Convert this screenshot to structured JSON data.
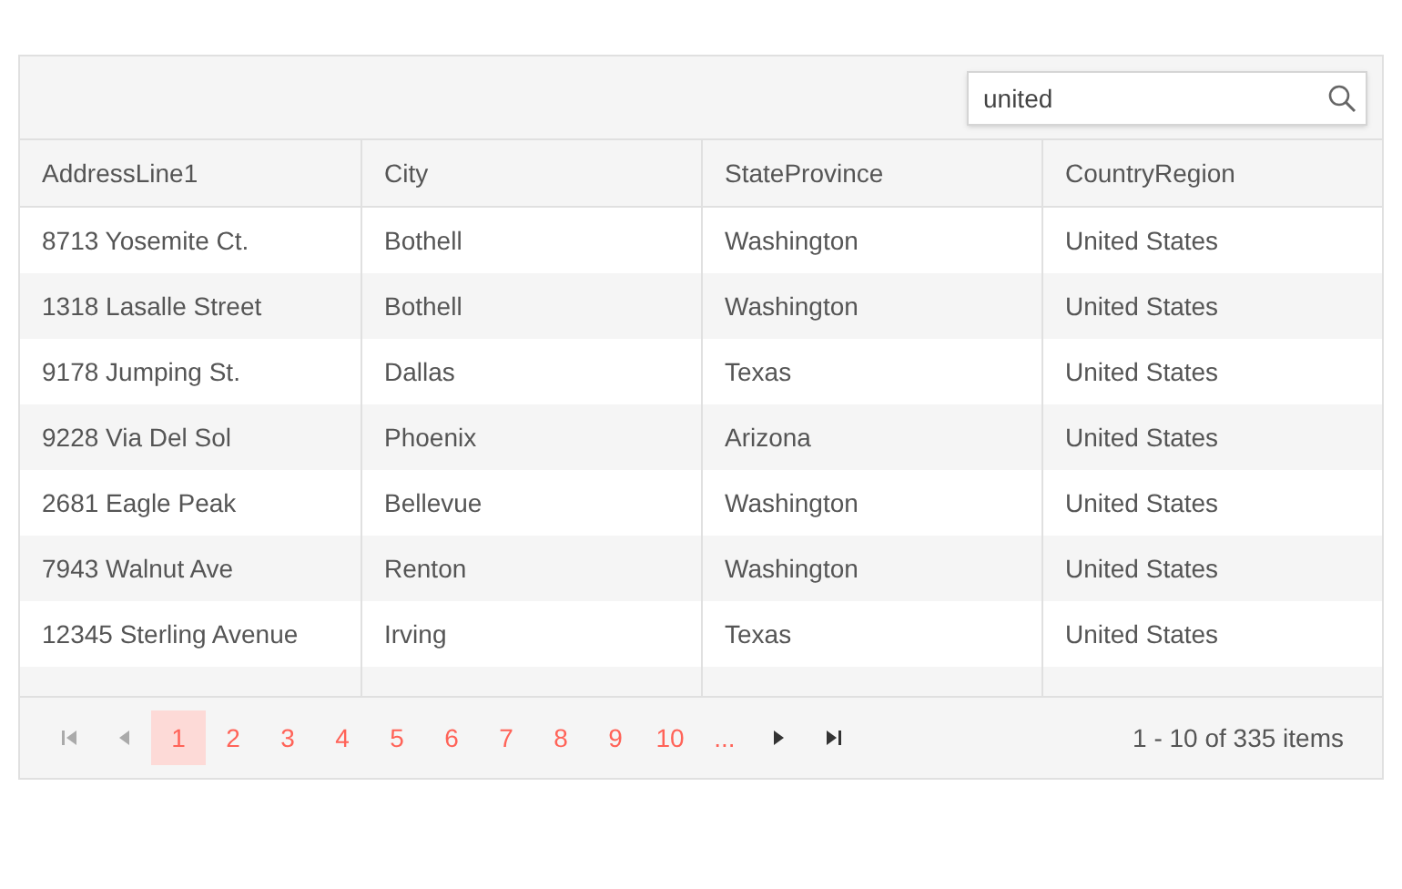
{
  "search": {
    "value": "united"
  },
  "table": {
    "columns": [
      "AddressLine1",
      "City",
      "StateProvince",
      "CountryRegion"
    ],
    "rows": [
      [
        "8713 Yosemite Ct.",
        "Bothell",
        "Washington",
        "United States"
      ],
      [
        "1318 Lasalle Street",
        "Bothell",
        "Washington",
        "United States"
      ],
      [
        "9178 Jumping St.",
        "Dallas",
        "Texas",
        "United States"
      ],
      [
        "9228 Via Del Sol",
        "Phoenix",
        "Arizona",
        "United States"
      ],
      [
        "2681 Eagle Peak",
        "Bellevue",
        "Washington",
        "United States"
      ],
      [
        "7943 Walnut Ave",
        "Renton",
        "Washington",
        "United States"
      ],
      [
        "12345 Sterling Avenue",
        "Irving",
        "Texas",
        "United States"
      ]
    ]
  },
  "pager": {
    "nav_start": [
      {
        "kind": "first",
        "disabled": true
      },
      {
        "kind": "prev",
        "disabled": true
      }
    ],
    "pages": [
      {
        "label": "1",
        "selected": true
      },
      {
        "label": "2",
        "selected": false
      },
      {
        "label": "3",
        "selected": false
      },
      {
        "label": "4",
        "selected": false
      },
      {
        "label": "5",
        "selected": false
      },
      {
        "label": "6",
        "selected": false
      },
      {
        "label": "7",
        "selected": false
      },
      {
        "label": "8",
        "selected": false
      },
      {
        "label": "9",
        "selected": false
      },
      {
        "label": "10",
        "selected": false
      },
      {
        "label": "...",
        "selected": false
      }
    ],
    "nav_end": [
      {
        "kind": "next",
        "disabled": false
      },
      {
        "kind": "last",
        "disabled": false
      }
    ],
    "info": "1 - 10 of 335 items"
  }
}
